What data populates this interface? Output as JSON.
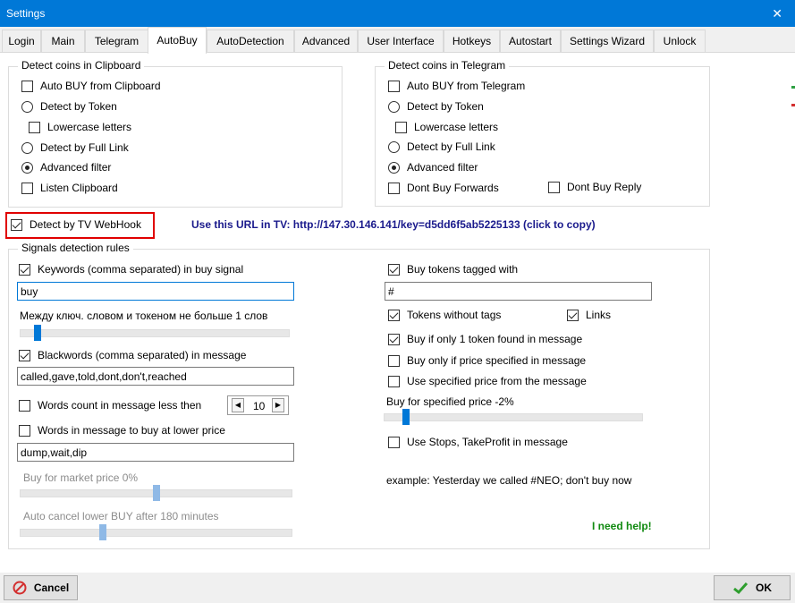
{
  "window": {
    "title": "Settings",
    "close_glyph": "✕"
  },
  "tabs": [
    {
      "label": "Login"
    },
    {
      "label": "Main"
    },
    {
      "label": "Telegram"
    },
    {
      "label": "AutoBuy",
      "active": true
    },
    {
      "label": "AutoDetection"
    },
    {
      "label": "Advanced"
    },
    {
      "label": "User Interface"
    },
    {
      "label": "Hotkeys"
    },
    {
      "label": "Autostart"
    },
    {
      "label": "Settings Wizard"
    },
    {
      "label": "Unlock"
    }
  ],
  "clipboard_group": {
    "title": "Detect coins in Clipboard",
    "auto_buy": {
      "label": "Auto BUY from Clipboard",
      "checked": false
    },
    "detect_by_token": {
      "label": "Detect by Token",
      "checked": false
    },
    "lowercase": {
      "label": "Lowercase letters",
      "checked": false
    },
    "detect_full_link": {
      "label": "Detect by Full Link",
      "checked": false
    },
    "advanced_filter": {
      "label": "Advanced filter",
      "checked": true
    },
    "listen_clipboard": {
      "label": "Listen Clipboard",
      "checked": false
    }
  },
  "telegram_group": {
    "title": "Detect coins in Telegram",
    "auto_buy": {
      "label": "Auto BUY from Telegram",
      "checked": false
    },
    "detect_by_token": {
      "label": "Detect by Token",
      "checked": false
    },
    "lowercase": {
      "label": "Lowercase letters",
      "checked": false
    },
    "detect_full_link": {
      "label": "Detect by Full Link",
      "checked": false
    },
    "advanced_filter": {
      "label": "Advanced filter",
      "checked": true
    },
    "dont_buy_forwards": {
      "label": "Dont Buy Forwards",
      "checked": false
    },
    "dont_buy_reply": {
      "label": "Dont Buy Reply",
      "checked": false
    }
  },
  "webhook": {
    "label": "Detect by TV WebHook",
    "checked": true,
    "url_text": "Use this URL in TV: http://147.30.146.141/key=d5dd6f5ab5225133 (click to copy)"
  },
  "signals": {
    "title": "Signals detection rules",
    "keywords": {
      "label": "Keywords (comma separated) in buy signal",
      "checked": true,
      "value": "buy"
    },
    "distance_label": "Между ключ. словом и токеном не больше 1 слов",
    "distance_level": 0.1,
    "blackwords": {
      "label": "Blackwords (comma separated) in message",
      "checked": true,
      "value": "called,gave,told,dont,don't,reached"
    },
    "words_count": {
      "label": "Words count in message less then",
      "checked": false,
      "value": "10"
    },
    "lower_price": {
      "label": "Words in message to buy at lower price",
      "checked": false,
      "value": "dump,wait,dip"
    },
    "market_price_label": "Buy for market price 0%",
    "market_price_level": 0.5,
    "auto_cancel_label": "Auto cancel lower BUY after 180 minutes",
    "auto_cancel_level": 0.3,
    "tagged": {
      "label": "Buy tokens tagged with",
      "checked": true,
      "value": "#"
    },
    "without_tags": {
      "label": "Tokens without tags",
      "checked": true
    },
    "links": {
      "label": "Links",
      "checked": true
    },
    "only_one_token": {
      "label": "Buy if only 1 token found in message",
      "checked": true
    },
    "only_if_price": {
      "label": "Buy only if price specified in message",
      "checked": false
    },
    "use_specified_price": {
      "label": "Use specified price from the message",
      "checked": false
    },
    "specified_price_label": "Buy for specified price -2%",
    "specified_price_level": 0.1,
    "use_stops": {
      "label": "Use Stops, TakeProfit in message",
      "checked": false
    },
    "example": "example: Yesterday we called #NEO; don't buy now",
    "help": "I need help!"
  },
  "buttons": {
    "cancel": "Cancel",
    "ok": "OK"
  },
  "colors": {
    "accent": "#0078d7",
    "highlight": "#e00000",
    "url": "#1a1a8c",
    "help": "#118a11"
  }
}
